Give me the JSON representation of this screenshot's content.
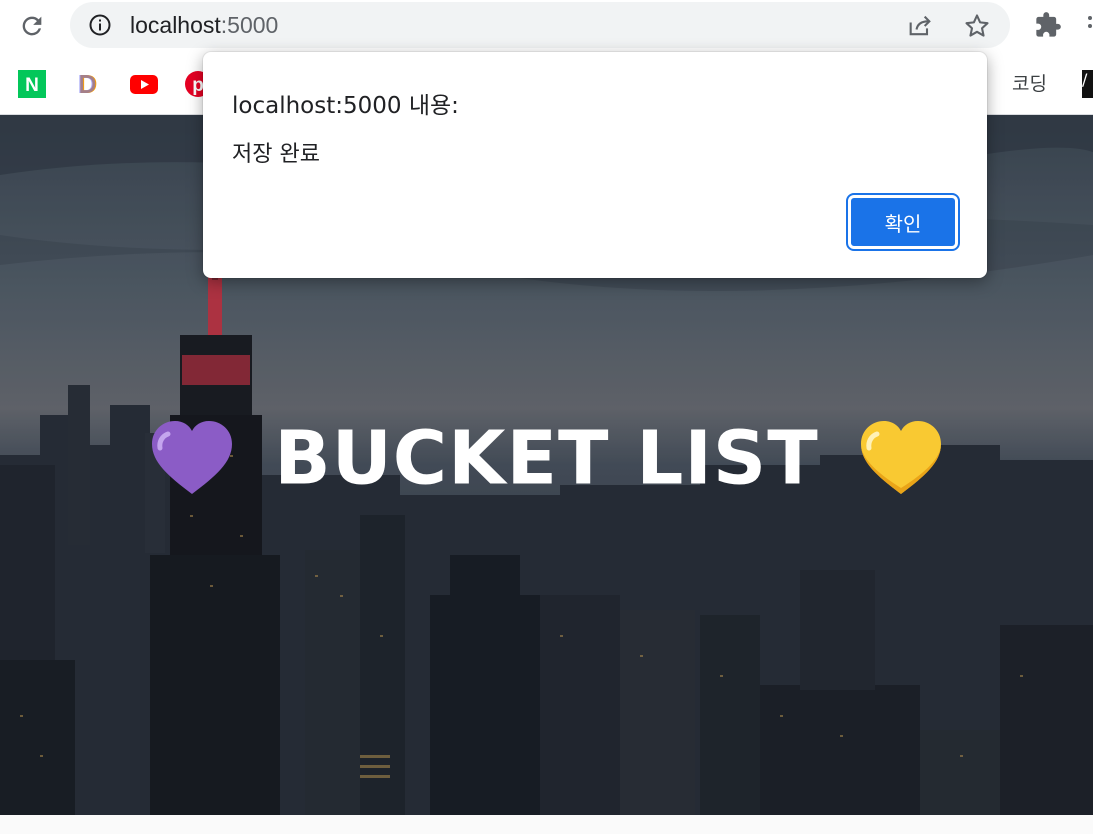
{
  "browser": {
    "url_host": "localhost",
    "url_port": ":5000",
    "bookmarks": [
      {
        "icon": "naver-icon",
        "label": "N"
      },
      {
        "icon": "daum-icon",
        "label": "D"
      },
      {
        "icon": "youtube-icon",
        "label": ""
      },
      {
        "icon": "pinterest-icon",
        "label": ""
      }
    ],
    "bookmark_folder_label": "코딩",
    "bookmark_last_label": "/"
  },
  "page": {
    "title": "BUCKET LIST",
    "left_heart": "purple-heart-icon",
    "right_heart": "yellow-heart-icon"
  },
  "alert": {
    "title": "localhost:5000 내용:",
    "message": "저장 완료",
    "ok_label": "확인"
  },
  "colors": {
    "accent": "#1a73e8",
    "purple_heart": "#8b5cc6",
    "yellow_heart": "#f9c932"
  }
}
